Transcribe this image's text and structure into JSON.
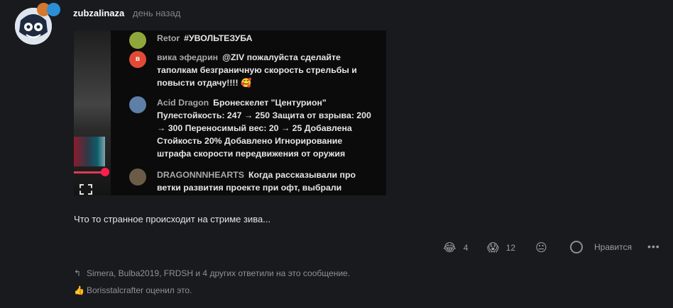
{
  "post": {
    "username": "zubzalinaza",
    "time": "день назад",
    "text": "Что то странное происходит на стриме зива..."
  },
  "embed": {
    "messages": [
      {
        "name": "Retor",
        "text": "#УВОЛЬТЕЗУБА"
      },
      {
        "name": "вика эфедрин",
        "avatar_letter": "в",
        "text": "@ZIV пожалуйста сделайте таполкам безграничную скорость стрельбы и повысти отдачу!!!! 🥰"
      },
      {
        "name": "Acid Dragon",
        "text": "Бронескелет \"Центурион\" Пулестойкость: 247 → 250 Защита от взрыва: 200 → 300 Переносимый вес: 20 → 25 Добавлена Стойкость 20% Добавлено Игнорирование штрафа скорости передвижения от оружия"
      },
      {
        "name": "DRAGONNNHEARTS",
        "text": "Когда рассказывали про ветки развития проекте при офт, выбрали"
      }
    ]
  },
  "reactions": [
    {
      "emoji": "😂",
      "count": "4"
    },
    {
      "emoji": "😱",
      "count": "12"
    },
    {
      "emoji": "😐",
      "count": ""
    }
  ],
  "like_label": "Нравится",
  "more_label": "•••",
  "replied_text": "Simera, Bulba2019, FRDSH и 4 других ответили на это сообщение.",
  "liked_text": "Borisstalcrafter оценил это."
}
